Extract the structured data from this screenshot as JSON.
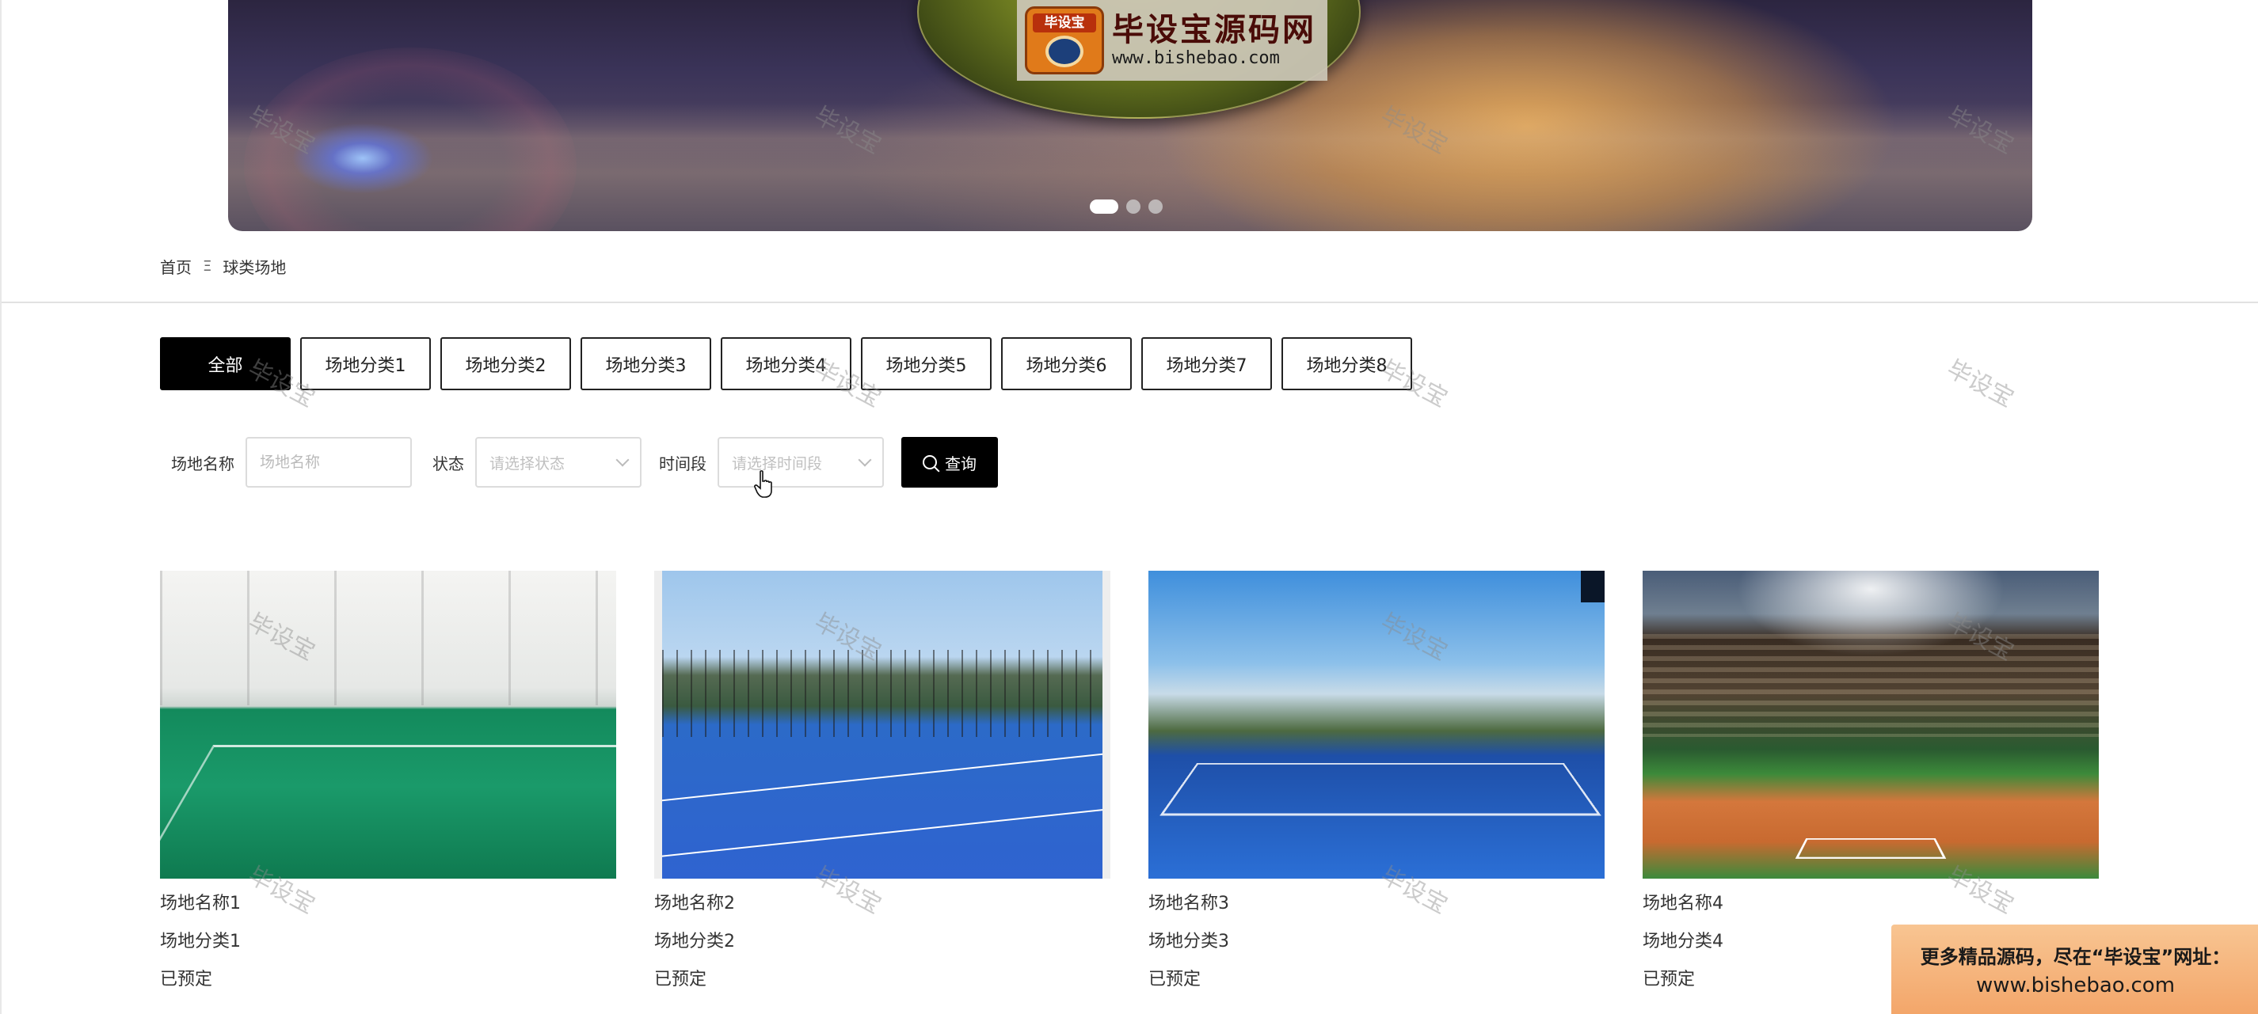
{
  "banner": {
    "logo_title": "毕设宝源码网",
    "logo_url": "www.bishebao.com",
    "logo_seal_text": "毕设宝",
    "dots": [
      {
        "active": true
      },
      {
        "active": false
      },
      {
        "active": false
      }
    ]
  },
  "breadcrumb": {
    "home": "首页",
    "separator": "Ξ",
    "current": "球类场地"
  },
  "tabs": [
    {
      "label": "全部",
      "active": true
    },
    {
      "label": "场地分类1",
      "active": false
    },
    {
      "label": "场地分类2",
      "active": false
    },
    {
      "label": "场地分类3",
      "active": false
    },
    {
      "label": "场地分类4",
      "active": false
    },
    {
      "label": "场地分类5",
      "active": false
    },
    {
      "label": "场地分类6",
      "active": false
    },
    {
      "label": "场地分类7",
      "active": false
    },
    {
      "label": "场地分类8",
      "active": false
    }
  ],
  "filters": {
    "name_label": "场地名称",
    "name_placeholder": "场地名称",
    "name_value": "",
    "status_label": "状态",
    "status_placeholder": "请选择状态",
    "time_label": "时间段",
    "time_placeholder": "请选择时间段",
    "search_label": "查询"
  },
  "cards": [
    {
      "name": "场地名称1",
      "category": "场地分类1",
      "status": "已预定"
    },
    {
      "name": "场地名称2",
      "category": "场地分类2",
      "status": "已预定"
    },
    {
      "name": "场地名称3",
      "category": "场地分类3",
      "status": "已预定"
    },
    {
      "name": "场地名称4",
      "category": "场地分类4",
      "status": "已预定"
    }
  ],
  "watermark_text": "毕设宝",
  "promo": {
    "line1": "更多精品源码，尽在“毕设宝”网址：",
    "line2": "www.bishebao.com"
  },
  "colors": {
    "primary": "#000000",
    "border": "#dcdcdc",
    "promo_bg": "#f3a66a"
  }
}
